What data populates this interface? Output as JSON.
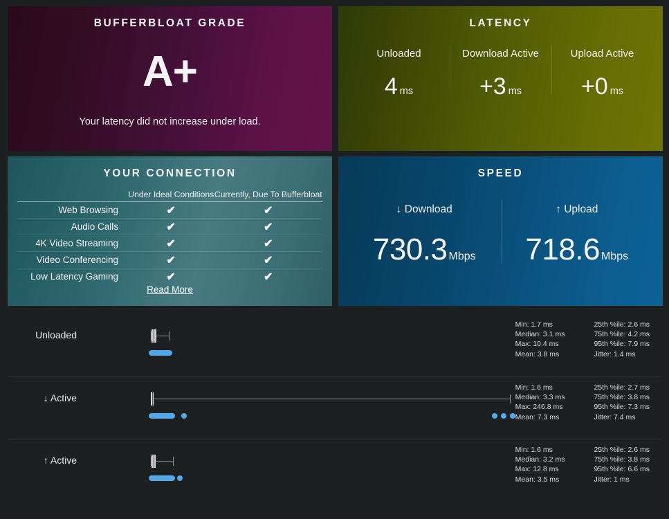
{
  "cards": {
    "grade": {
      "title": "BUFFERBLOAT GRADE",
      "value": "A+",
      "note": "Your latency did not increase under load."
    },
    "latency": {
      "title": "LATENCY",
      "columns": [
        {
          "label": "Unloaded",
          "value": "4",
          "unit": "ms"
        },
        {
          "label": "Download Active",
          "value": "+3",
          "unit": "ms"
        },
        {
          "label": "Upload Active",
          "value": "+0",
          "unit": "ms"
        }
      ]
    },
    "connection": {
      "title": "YOUR CONNECTION",
      "headers": [
        "",
        "Under Ideal Conditions",
        "Currently, Due To Bufferbloat"
      ],
      "rows": [
        {
          "name": "Web Browsing",
          "ideal": "✔",
          "current": "✔"
        },
        {
          "name": "Audio Calls",
          "ideal": "✔",
          "current": "✔"
        },
        {
          "name": "4K Video Streaming",
          "ideal": "✔",
          "current": "✔"
        },
        {
          "name": "Video Conferencing",
          "ideal": "✔",
          "current": "✔"
        },
        {
          "name": "Low Latency Gaming",
          "ideal": "✔",
          "current": "✔"
        }
      ],
      "read_more": "Read More"
    },
    "speed": {
      "title": "SPEED",
      "columns": [
        {
          "label": "↓ Download",
          "value": "730.3",
          "unit": "Mbps"
        },
        {
          "label": "↑ Upload",
          "value": "718.6",
          "unit": "Mbps"
        }
      ]
    }
  },
  "details": {
    "rows": [
      {
        "label": "Unloaded",
        "stats_left": [
          "Min: 1.7 ms",
          "Median: 3.1 ms",
          "Max: 10.4 ms",
          "Mean: 3.8 ms"
        ],
        "stats_right": [
          "25th %ile: 2.6 ms",
          "75th %ile: 4.2 ms",
          "95th %ile: 7.9 ms",
          "Jitter: 1.4 ms"
        ]
      },
      {
        "label": "↓ Active",
        "stats_left": [
          "Min: 1.6 ms",
          "Median: 3.3 ms",
          "Max: 246.8 ms",
          "Mean: 7.3 ms"
        ],
        "stats_right": [
          "25th %ile: 2.7 ms",
          "75th %ile: 3.8 ms",
          "95th %ile: 7.3 ms",
          "Jitter: 7.4 ms"
        ]
      },
      {
        "label": "↑ Active",
        "stats_left": [
          "Min: 1.6 ms",
          "Median: 3.2 ms",
          "Max: 12.8 ms",
          "Mean: 3.5 ms"
        ],
        "stats_right": [
          "25th %ile: 2.6 ms",
          "75th %ile: 3.8 ms",
          "95th %ile: 6.6 ms",
          "Jitter: 1 ms"
        ]
      }
    ]
  },
  "chart_data": [
    {
      "type": "box",
      "name": "Unloaded latency distribution",
      "unit": "ms",
      "min": 1.7,
      "p25": 2.6,
      "median": 3.1,
      "p75": 4.2,
      "p95": 7.9,
      "max": 10.4,
      "mean": 3.8,
      "jitter": 1.4,
      "axis_max_ms": 246.8,
      "samples_ms": [
        1.7,
        2.1,
        2.4,
        2.6,
        2.9,
        3.1,
        3.4,
        3.8,
        4.2,
        5.1,
        6.4,
        7.9,
        10.4
      ]
    },
    {
      "type": "box",
      "name": "Download Active latency distribution",
      "unit": "ms",
      "min": 1.6,
      "p25": 2.7,
      "median": 3.3,
      "p75": 3.8,
      "p95": 7.3,
      "max": 246.8,
      "mean": 7.3,
      "jitter": 7.4,
      "axis_max_ms": 246.8,
      "samples_ms": [
        1.6,
        2.0,
        2.3,
        2.7,
        3.0,
        3.3,
        3.6,
        3.8,
        4.4,
        5.5,
        7.3,
        12.0,
        21.0,
        232.0,
        239.0,
        246.8
      ]
    },
    {
      "type": "box",
      "name": "Upload Active latency distribution",
      "unit": "ms",
      "min": 1.6,
      "p25": 2.6,
      "median": 3.2,
      "p75": 3.8,
      "p95": 6.6,
      "max": 12.8,
      "mean": 3.5,
      "jitter": 1,
      "axis_max_ms": 246.8,
      "samples_ms": [
        1.6,
        2.0,
        2.3,
        2.6,
        2.9,
        3.2,
        3.5,
        3.8,
        4.4,
        5.2,
        6.6,
        12.8
      ]
    }
  ],
  "colors": {
    "background": "#1d2021",
    "grade_card": "#5c1147",
    "latency_card": "#636b04",
    "connection_card": "#2d666d",
    "speed_card": "#0c5e92",
    "dot": "#53a8e8",
    "whisker": "#8c8c8c",
    "box_fill": "#c9c9c9"
  }
}
